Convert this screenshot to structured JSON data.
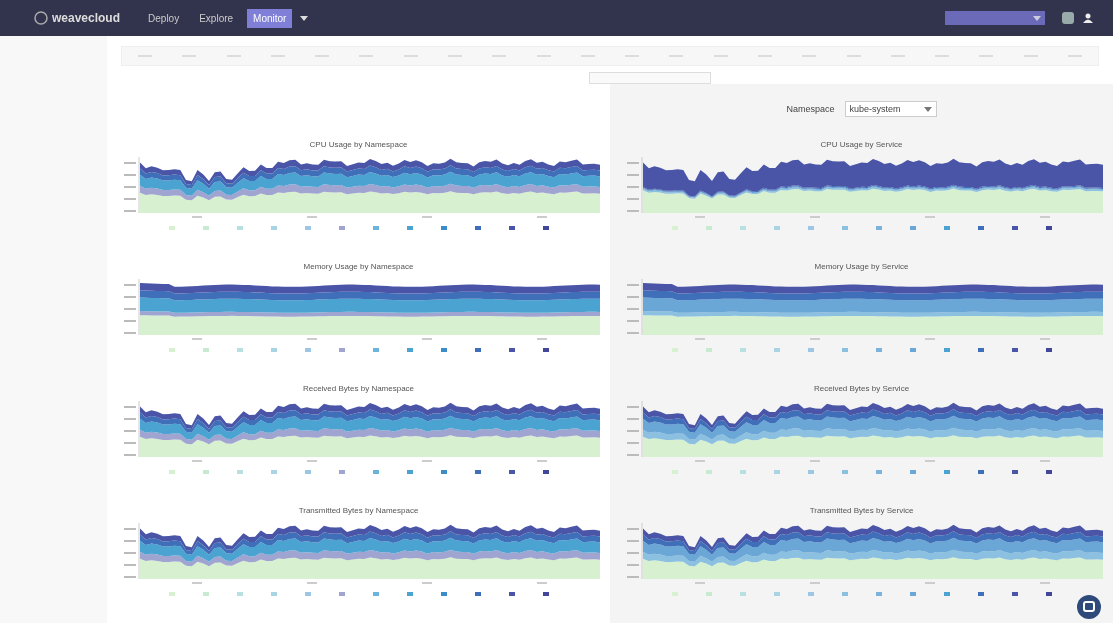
{
  "header": {
    "logo": "weavecloud",
    "nav": [
      {
        "label": "Deploy",
        "selected": false
      },
      {
        "label": "Explore",
        "selected": false
      },
      {
        "label": "Monitor",
        "selected": true
      }
    ]
  },
  "namespace_filter": {
    "label": "Namespace",
    "value": "kube-system"
  },
  "left_charts": [
    {
      "title": "CPU Usage by Namespace",
      "kind": "cpu",
      "legend": [
        {
          "color": "#d6f0d0"
        },
        {
          "color": "#c8ead0"
        },
        {
          "color": "#b8e0e0"
        },
        {
          "color": "#a9d4e4"
        },
        {
          "color": "#9cc6e6"
        },
        {
          "color": "#a0a4d0"
        },
        {
          "color": "#6cb4dc"
        },
        {
          "color": "#4aa3d0"
        },
        {
          "color": "#3b8cc8"
        },
        {
          "color": "#3f6fb8"
        },
        {
          "color": "#4a55a8"
        },
        {
          "color": "#43479a"
        }
      ]
    },
    {
      "title": "Memory Usage by Namespace",
      "kind": "flat",
      "legend": [
        {
          "color": "#d6f0d0"
        },
        {
          "color": "#c8ead0"
        },
        {
          "color": "#b8e0e0"
        },
        {
          "color": "#a9d4e4"
        },
        {
          "color": "#9cc6e6"
        },
        {
          "color": "#a0a4d0"
        },
        {
          "color": "#6cb4dc"
        },
        {
          "color": "#4aa3d0"
        },
        {
          "color": "#3b8cc8"
        },
        {
          "color": "#3f6fb8"
        },
        {
          "color": "#4a55a8"
        },
        {
          "color": "#43479a"
        }
      ]
    },
    {
      "title": "Received Bytes by Namespace",
      "kind": "cpu",
      "legend": [
        {
          "color": "#d6f0d0"
        },
        {
          "color": "#c8ead0"
        },
        {
          "color": "#b8e0e0"
        },
        {
          "color": "#a9d4e4"
        },
        {
          "color": "#9cc6e6"
        },
        {
          "color": "#a0a4d0"
        },
        {
          "color": "#6cb4dc"
        },
        {
          "color": "#4aa3d0"
        },
        {
          "color": "#3b8cc8"
        },
        {
          "color": "#3f6fb8"
        },
        {
          "color": "#4a55a8"
        },
        {
          "color": "#43479a"
        }
      ]
    },
    {
      "title": "Transmitted Bytes by Namespace",
      "kind": "cpu",
      "legend": [
        {
          "color": "#d6f0d0"
        },
        {
          "color": "#c8ead0"
        },
        {
          "color": "#b8e0e0"
        },
        {
          "color": "#a9d4e4"
        },
        {
          "color": "#9cc6e6"
        },
        {
          "color": "#a0a4d0"
        },
        {
          "color": "#6cb4dc"
        },
        {
          "color": "#4aa3d0"
        },
        {
          "color": "#3b8cc8"
        },
        {
          "color": "#3f6fb8"
        },
        {
          "color": "#4a55a8"
        },
        {
          "color": "#43479a"
        }
      ]
    }
  ],
  "right_charts": [
    {
      "title": "CPU Usage by Service",
      "kind": "band",
      "legend": [
        {
          "color": "#d6f0d0"
        },
        {
          "color": "#c8ead0"
        },
        {
          "color": "#b8e0e0"
        },
        {
          "color": "#a9d4e4"
        },
        {
          "color": "#9cc6e6"
        },
        {
          "color": "#8cc0e0"
        },
        {
          "color": "#7ab4dc"
        },
        {
          "color": "#6aa6d6"
        },
        {
          "color": "#4aa3d0"
        },
        {
          "color": "#3f6fb8"
        },
        {
          "color": "#4a55a8"
        },
        {
          "color": "#43479a"
        }
      ]
    },
    {
      "title": "Memory Usage by Service",
      "kind": "flat",
      "legend": [
        {
          "color": "#d6f0d0"
        },
        {
          "color": "#c8ead0"
        },
        {
          "color": "#b8e0e0"
        },
        {
          "color": "#a9d4e4"
        },
        {
          "color": "#9cc6e6"
        },
        {
          "color": "#8cc0e0"
        },
        {
          "color": "#7ab4dc"
        },
        {
          "color": "#6aa6d6"
        },
        {
          "color": "#4aa3d0"
        },
        {
          "color": "#3f6fb8"
        },
        {
          "color": "#4a55a8"
        },
        {
          "color": "#43479a"
        }
      ]
    },
    {
      "title": "Received Bytes by Service",
      "kind": "cpu",
      "legend": [
        {
          "color": "#d6f0d0"
        },
        {
          "color": "#c8ead0"
        },
        {
          "color": "#b8e0e0"
        },
        {
          "color": "#a9d4e4"
        },
        {
          "color": "#9cc6e6"
        },
        {
          "color": "#8cc0e0"
        },
        {
          "color": "#7ab4dc"
        },
        {
          "color": "#6aa6d6"
        },
        {
          "color": "#4aa3d0"
        },
        {
          "color": "#3f6fb8"
        },
        {
          "color": "#4a55a8"
        },
        {
          "color": "#43479a"
        }
      ]
    },
    {
      "title": "Transmitted Bytes by Service",
      "kind": "cpu",
      "legend": [
        {
          "color": "#d6f0d0"
        },
        {
          "color": "#c8ead0"
        },
        {
          "color": "#b8e0e0"
        },
        {
          "color": "#a9d4e4"
        },
        {
          "color": "#9cc6e6"
        },
        {
          "color": "#8cc0e0"
        },
        {
          "color": "#7ab4dc"
        },
        {
          "color": "#6aa6d6"
        },
        {
          "color": "#4aa3d0"
        },
        {
          "color": "#3f6fb8"
        },
        {
          "color": "#4a55a8"
        },
        {
          "color": "#43479a"
        }
      ]
    }
  ]
}
